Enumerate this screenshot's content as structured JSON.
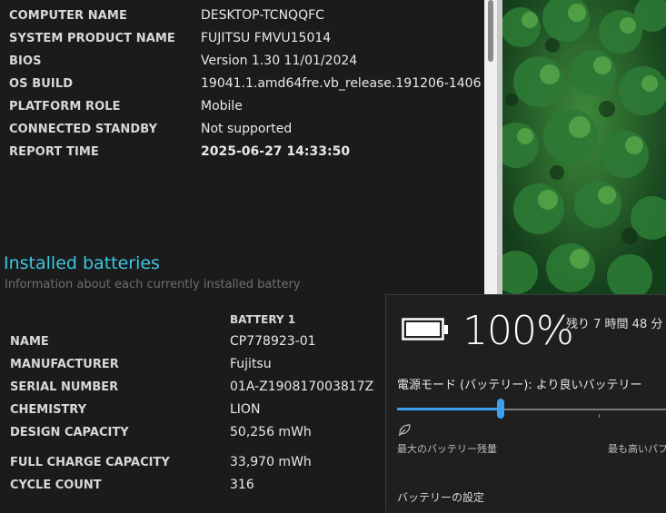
{
  "system_info": [
    {
      "label": "COMPUTER NAME",
      "value": "DESKTOP-TCNQQFC"
    },
    {
      "label": "SYSTEM PRODUCT NAME",
      "value": "FUJITSU FMVU15014"
    },
    {
      "label": "BIOS",
      "value": "Version 1.30 11/01/2024"
    },
    {
      "label": "OS BUILD",
      "value": "19041.1.amd64fre.vb_release.191206-1406"
    },
    {
      "label": "PLATFORM ROLE",
      "value": "Mobile"
    },
    {
      "label": "CONNECTED STANDBY",
      "value": "Not supported"
    },
    {
      "label": "REPORT TIME",
      "value": "2025-06-27  14:33:50"
    }
  ],
  "batteries": {
    "title": "Installed batteries",
    "subtitle": "Information about each currently installed battery",
    "column_header": "BATTERY 1",
    "rows": [
      {
        "label": "NAME",
        "value": "CP778923-01"
      },
      {
        "label": "MANUFACTURER",
        "value": "Fujitsu"
      },
      {
        "label": "SERIAL NUMBER",
        "value": "01A-Z190817003817Z"
      },
      {
        "label": "CHEMISTRY",
        "value": "LION"
      },
      {
        "label": "DESIGN CAPACITY",
        "value": "50,256 mWh"
      },
      {
        "label": "FULL CHARGE CAPACITY",
        "value": "33,970 mWh"
      },
      {
        "label": "CYCLE COUNT",
        "value": "316"
      }
    ]
  },
  "flyout": {
    "percent": "100%",
    "remaining": "残り 7 時間 48 分",
    "power_mode": "電源モード (バッテリー): より良いバッテリー",
    "slider_level": 0.38,
    "left_label": "最大のバッテリー残量",
    "right_label": "最も高いパフォーマンス",
    "settings_link": "バッテリーの設定",
    "battery_icon": "battery-full-icon",
    "leaf_icon": "battery-saver-leaf-icon",
    "accent_color": "#3aa0f0"
  },
  "colors": {
    "section_title": "#3cc7e0",
    "background": "#1b1b1b"
  }
}
